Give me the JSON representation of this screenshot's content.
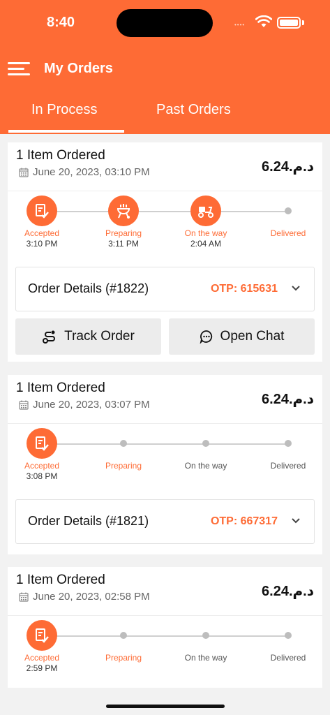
{
  "status_bar": {
    "time": "8:40",
    "dots": "••••"
  },
  "header": {
    "title": "My Orders"
  },
  "tabs": [
    {
      "label": "In Process",
      "active": true
    },
    {
      "label": "Past Orders",
      "active": false
    }
  ],
  "orders": [
    {
      "title": "1 Item Ordered",
      "date": "June 20, 2023, 03:10 PM",
      "price": "د.م.6.24",
      "steps": [
        {
          "label": "Accepted",
          "time": "3:10 PM",
          "done": true,
          "icon": "clipboard-check-icon"
        },
        {
          "label": "Preparing",
          "time": "3:11 PM",
          "done": true,
          "icon": "grill-icon"
        },
        {
          "label": "On the way",
          "time": "2:04 AM",
          "done": true,
          "icon": "scooter-icon"
        },
        {
          "label": "Delivered",
          "time": "",
          "done": false
        }
      ],
      "details_label": "Order Details (#1822)",
      "otp": "OTP: 615631",
      "track_button": "Track Order",
      "chat_button": "Open Chat"
    },
    {
      "title": "1 Item Ordered",
      "date": "June 20, 2023, 03:07 PM",
      "price": "د.م.6.24",
      "steps": [
        {
          "label": "Accepted",
          "time": "3:08 PM",
          "done": true,
          "icon": "clipboard-check-icon"
        },
        {
          "label": "Preparing",
          "time": "",
          "done": false
        },
        {
          "label": "On the way",
          "time": "",
          "done": false
        },
        {
          "label": "Delivered",
          "time": "",
          "done": false
        }
      ],
      "details_label": "Order Details (#1821)",
      "otp": "OTP: 667317"
    },
    {
      "title": "1 Item Ordered",
      "date": "June 20, 2023, 02:58 PM",
      "price": "د.م.6.24",
      "steps": [
        {
          "label": "Accepted",
          "time": "2:59 PM",
          "done": true,
          "icon": "clipboard-check-icon"
        },
        {
          "label": "Preparing",
          "time": "",
          "done": false
        },
        {
          "label": "On the way",
          "time": "",
          "done": false
        },
        {
          "label": "Delivered",
          "time": "",
          "done": false
        }
      ]
    }
  ],
  "colors": {
    "accent": "#fe6b35",
    "background": "#f2f2f2",
    "card": "#ffffff",
    "button": "#ececec"
  }
}
